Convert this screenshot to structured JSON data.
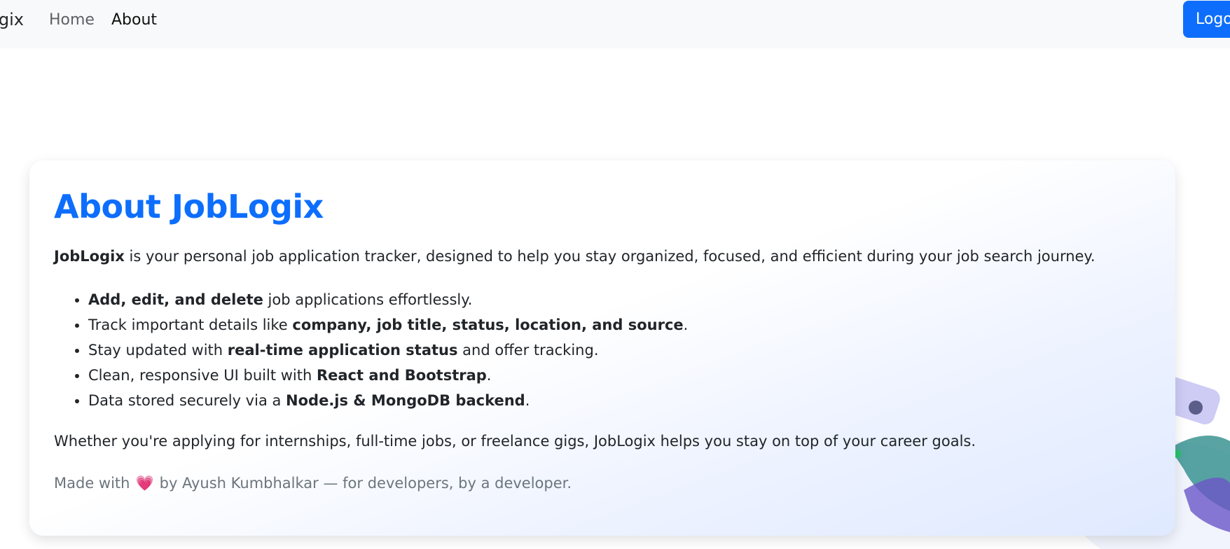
{
  "nav": {
    "brand": "JobLogix",
    "links": [
      {
        "label": "Home"
      },
      {
        "label": "About"
      }
    ],
    "logout_label": "Logout"
  },
  "about": {
    "title": "About JobLogix",
    "intro_brand": "JobLogix",
    "intro_rest": " is your personal job application tracker, designed to help you stay organized, focused, and efficient during your job search journey.",
    "features": [
      {
        "pre": "",
        "bold": "Add, edit, and delete",
        "post": " job applications effortlessly."
      },
      {
        "pre": "Track important details like ",
        "bold": "company, job title, status, location, and source",
        "post": "."
      },
      {
        "pre": "Stay updated with ",
        "bold": "real-time application status",
        "post": " and offer tracking."
      },
      {
        "pre": "Clean, responsive UI built with ",
        "bold": "React and Bootstrap",
        "post": "."
      },
      {
        "pre": "Data stored securely via a ",
        "bold": "Node.js & MongoDB backend",
        "post": "."
      }
    ],
    "outro": "Whether you're applying for internships, full-time jobs, or freelance gigs, JobLogix helps you stay on top of your career goals.",
    "credit_pre": "Made with",
    "credit_heart": "💗",
    "credit_post": "by Ayush Kumbhalkar — for developers, by a developer."
  },
  "colors": {
    "accent": "#0d6efd",
    "navbar_bg": "#f8f9fa",
    "muted_text": "#6c757d"
  },
  "icons": {
    "heart": "heart-icon"
  }
}
